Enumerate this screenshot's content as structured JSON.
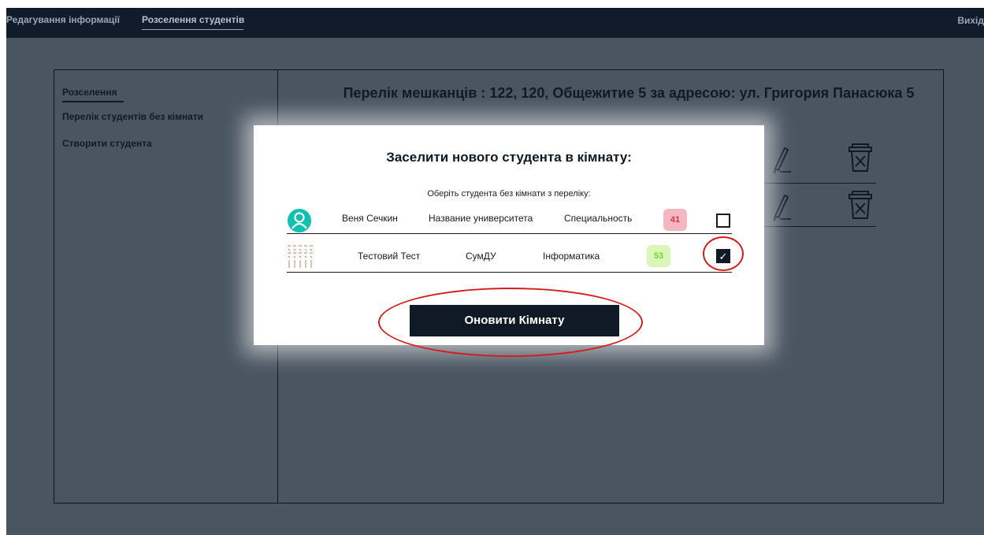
{
  "topbar": {
    "nav": [
      "Редагування інформації",
      "Розселення студентів"
    ],
    "logout_label": "Вихід"
  },
  "sidebar": {
    "items": [
      {
        "label": "Розселення",
        "active": true
      },
      {
        "label": "Перелік студентів без кімнати",
        "active": false
      },
      {
        "label": "Створити студента",
        "active": false
      }
    ]
  },
  "main": {
    "title": "Перелік мешканців : 122, 120, Общежитие 5 за адресою: ул. Григория Панасюка 5"
  },
  "modal": {
    "title": "Заселити нового студента в кімнату:",
    "subtitle": "Оберіть студента без кімнати з переліку:",
    "students": [
      {
        "name": "Веня Сечкин",
        "university": "Название университета",
        "specialty": "Специальность",
        "score": "41",
        "score_color": "#f4b6c0",
        "score_text_color": "#d8344a",
        "avatar": "person-icon",
        "checked": false
      },
      {
        "name": "Тестовий Тест",
        "university": "СумДУ",
        "specialty": "Інформатика",
        "score": "53",
        "score_color": "#d9f7b8",
        "score_text_color": "#7bd32a",
        "avatar": "pattern-avatar",
        "checked": true
      }
    ],
    "submit_label": "Оновити Кімнату",
    "check_glyph": "✓"
  },
  "colors": {
    "topbar": "#101c2a",
    "background": "#4a5562",
    "annotation": "#d81c1c"
  }
}
